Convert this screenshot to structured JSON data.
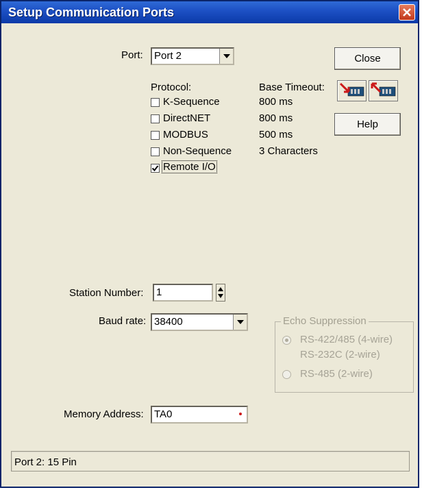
{
  "window": {
    "title": "Setup Communication Ports"
  },
  "port": {
    "label": "Port:",
    "value": "Port 2"
  },
  "buttons": {
    "close": "Close",
    "help": "Help"
  },
  "protocol": {
    "header": "Protocol:",
    "timeout_header": "Base Timeout:",
    "items": [
      {
        "label": "K-Sequence",
        "timeout": "800 ms",
        "checked": false
      },
      {
        "label": "DirectNET",
        "timeout": "800 ms",
        "checked": false
      },
      {
        "label": "MODBUS",
        "timeout": "500 ms",
        "checked": false
      },
      {
        "label": "Non-Sequence",
        "timeout": "3 Characters",
        "checked": false
      },
      {
        "label": "Remote I/O",
        "timeout": "",
        "checked": true
      }
    ]
  },
  "station": {
    "label": "Station Number:",
    "value": "1"
  },
  "baud": {
    "label": "Baud rate:",
    "value": "38400"
  },
  "echo": {
    "legend": "Echo Suppression",
    "option1_line1": "RS-422/485 (4-wire)",
    "option1_line2": "RS-232C (2-wire)",
    "option2": "RS-485 (2-wire)",
    "selected": "RS-422/485 (4-wire)",
    "enabled": false
  },
  "memory": {
    "label": "Memory Address:",
    "value": "TA0"
  },
  "status": {
    "text": "Port 2: 15 Pin"
  },
  "icons": {
    "write_icon": "plc-write-icon",
    "read_icon": "plc-read-icon",
    "accent": "#cc1a1a"
  }
}
